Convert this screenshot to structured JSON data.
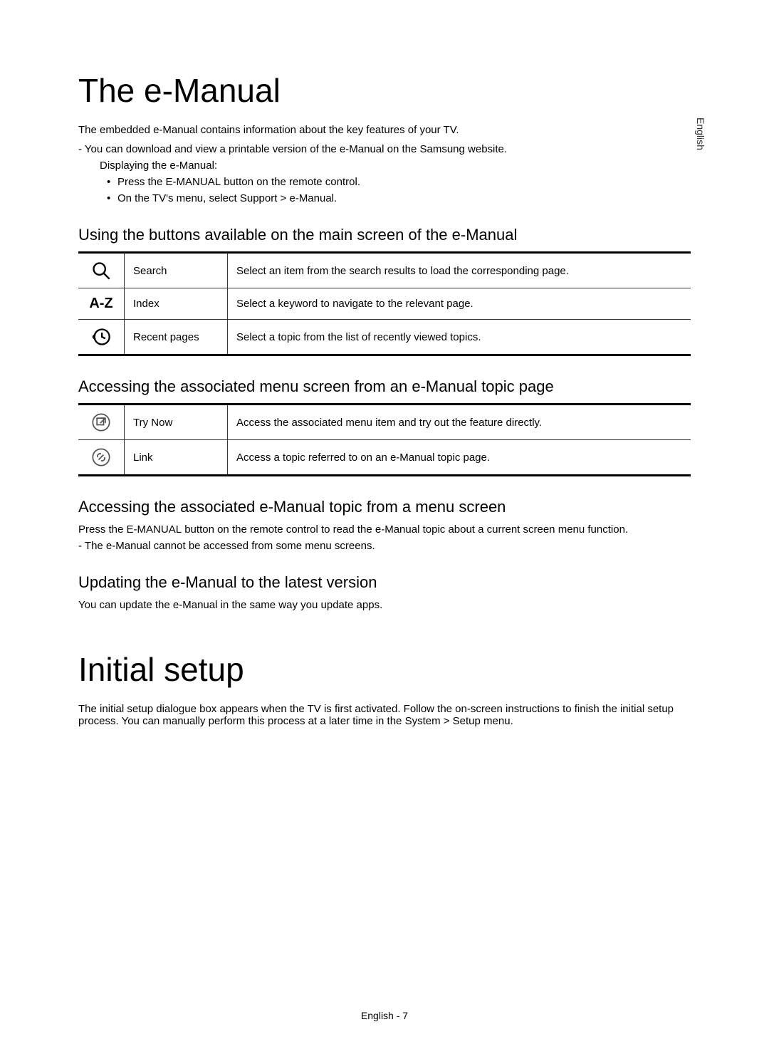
{
  "side_language": "English",
  "h1_a": "The e-Manual",
  "intro_a": "The embedded e-Manual contains information about the key features of your TV.",
  "dash_a": "You can download and view a printable version of the e-Manual on the Samsung website.",
  "indent_a": "Displaying the e-Manual:",
  "bullet_a1_pre": "Press the ",
  "bullet_a1_bold": "E-MANUAL",
  "bullet_a1_post": " button on the remote control.",
  "bullet_a2_pre": "On the TV's menu, select ",
  "bullet_a2_bold": "Support > e-Manual",
  "bullet_a2_post": ".",
  "h2_a": "Using the buttons available on the main screen of the e-Manual",
  "table_a": [
    {
      "icon": "search",
      "label": "Search",
      "desc": "Select an item from the search results to load the corresponding page."
    },
    {
      "icon": "az",
      "label": "Index",
      "desc": "Select a keyword to navigate to the relevant page."
    },
    {
      "icon": "recent",
      "label": "Recent pages",
      "desc": "Select a topic from the list of recently viewed topics."
    }
  ],
  "h2_b": "Accessing the associated menu screen from an e-Manual topic page",
  "table_b": [
    {
      "icon": "trynow",
      "label": "Try Now",
      "desc": "Access the associated menu item and try out the feature directly."
    },
    {
      "icon": "link",
      "label": "Link",
      "desc": "Access a topic referred to on an e-Manual topic page."
    }
  ],
  "h2_c": "Accessing the associated e-Manual topic from a menu screen",
  "c_p1_pre": "Press the ",
  "c_p1_bold": "E-MANUAL",
  "c_p1_post": " button on the remote control to read the e-Manual topic about a current screen menu function.",
  "c_dash": "The e-Manual cannot be accessed from some menu screens.",
  "h2_d": "Updating the e-Manual to the latest version",
  "d_p1": "You can update the e-Manual in the same way you update apps.",
  "h1_b": "Initial setup",
  "b_p1_pre": "The initial setup dialogue box appears when the TV is first activated. Follow the on-screen instructions to finish the initial setup process. You can manually perform this process at a later time in the ",
  "b_p1_bold": "System > Setup",
  "b_p1_post": " menu.",
  "footer": "English - 7"
}
